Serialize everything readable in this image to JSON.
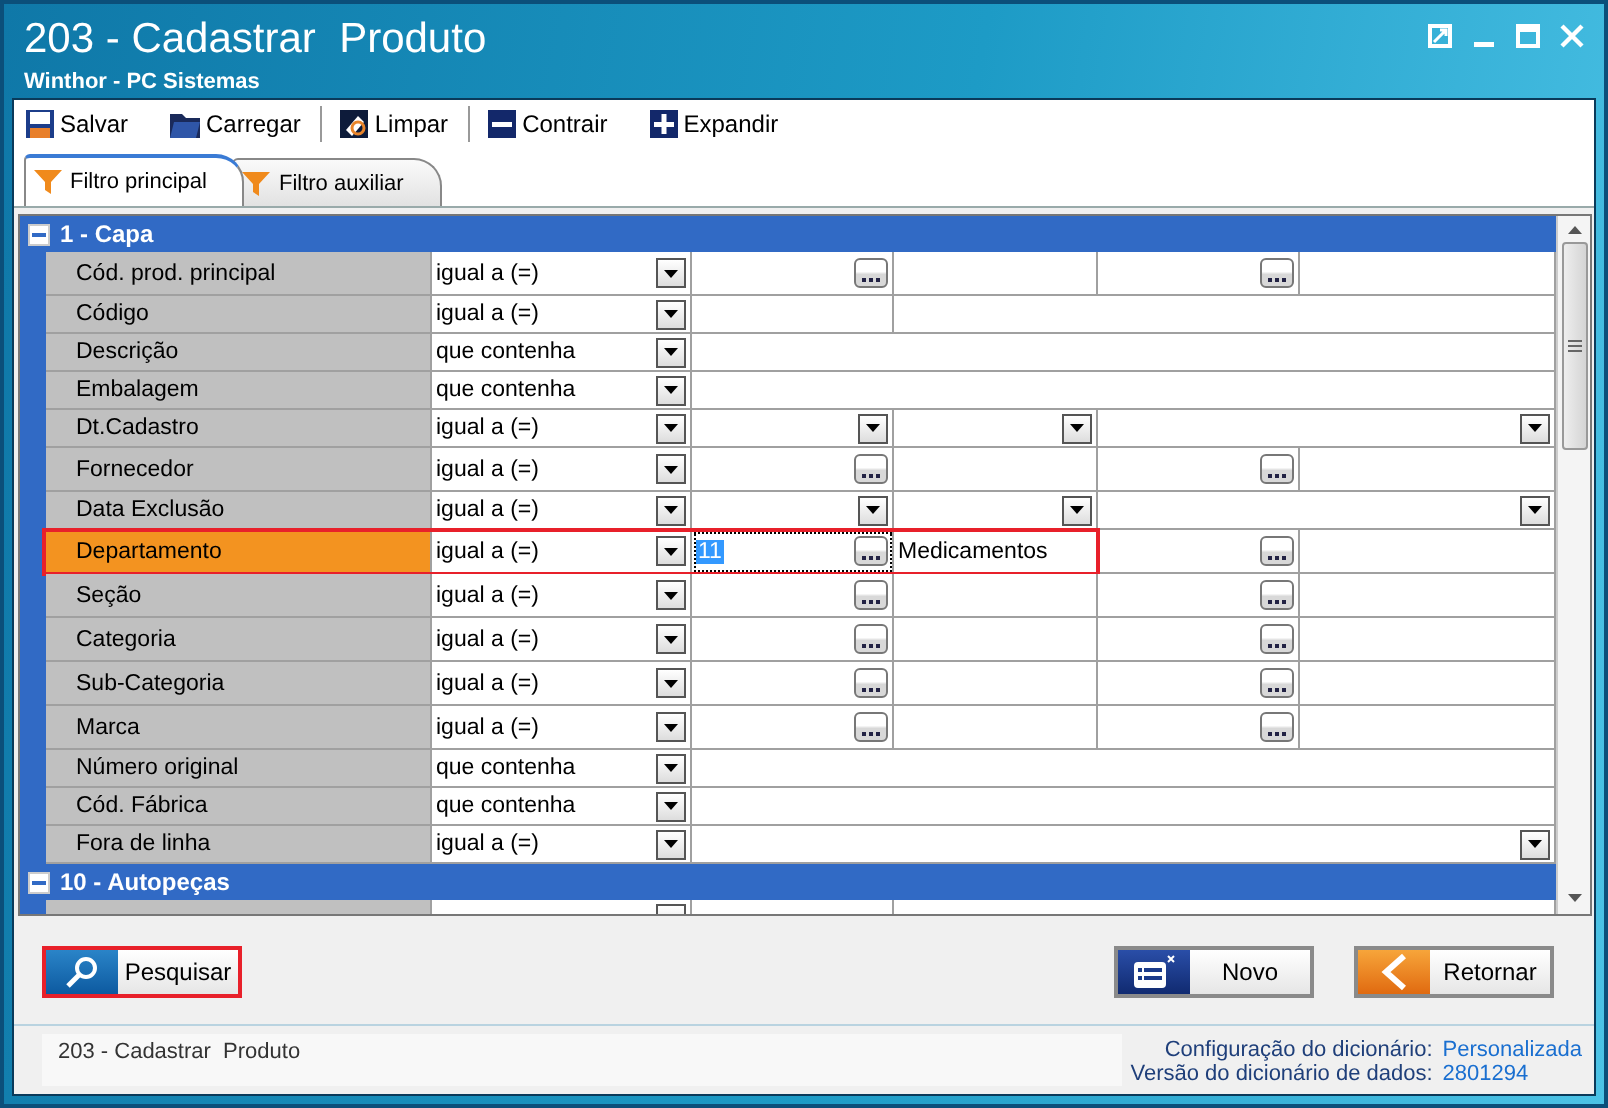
{
  "window": {
    "title": "203 - Cadastrar  Produto",
    "subtitle": "Winthor - PC Sistemas"
  },
  "toolbar": [
    {
      "label": "Salvar"
    },
    {
      "label": "Carregar"
    },
    {
      "label": "Limpar"
    },
    {
      "label": "Contrair"
    },
    {
      "label": "Expandir"
    }
  ],
  "tabs": [
    {
      "label": "Filtro principal",
      "selected": true
    },
    {
      "label": "Filtro auxiliar",
      "selected": false
    }
  ],
  "sections": [
    {
      "title": "1 - Capa",
      "expanded": true,
      "rows": [
        {
          "label": "Cód. prod. principal",
          "operator": "igual a (=)",
          "kind": "lookup",
          "selected": false,
          "highlighted": false
        },
        {
          "label": "Código",
          "operator": "igual a (=)",
          "kind": "text_pair",
          "selected": false,
          "highlighted": false
        },
        {
          "label": "Descrição",
          "operator": "que contenha",
          "kind": "text",
          "selected": false,
          "highlighted": false
        },
        {
          "label": "Embalagem",
          "operator": "que contenha",
          "kind": "text",
          "selected": false,
          "highlighted": false
        },
        {
          "label": "Dt.Cadastro",
          "operator": "igual a (=)",
          "kind": "date_range",
          "selected": false,
          "highlighted": false
        },
        {
          "label": "Fornecedor",
          "operator": "igual a (=)",
          "kind": "lookup",
          "selected": false,
          "highlighted": false
        },
        {
          "label": "Data Exclusão",
          "operator": "igual a (=)",
          "kind": "date_range",
          "selected": false,
          "highlighted": false
        },
        {
          "label": "Departamento",
          "operator": "igual a (=)",
          "kind": "lookup",
          "selected": true,
          "highlighted": true,
          "value": "11",
          "description": "Medicamentos"
        },
        {
          "label": "Seção",
          "operator": "igual a (=)",
          "kind": "lookup",
          "selected": false,
          "highlighted": false
        },
        {
          "label": "Categoria",
          "operator": "igual a (=)",
          "kind": "lookup",
          "selected": false,
          "highlighted": false
        },
        {
          "label": "Sub-Categoria",
          "operator": "igual a (=)",
          "kind": "lookup",
          "selected": false,
          "highlighted": false
        },
        {
          "label": "Marca",
          "operator": "igual a (=)",
          "kind": "lookup",
          "selected": false,
          "highlighted": false
        },
        {
          "label": "Número original",
          "operator": "que contenha",
          "kind": "text",
          "selected": false,
          "highlighted": false
        },
        {
          "label": "Cód. Fábrica",
          "operator": "que contenha",
          "kind": "text",
          "selected": false,
          "highlighted": false
        },
        {
          "label": "Fora de linha",
          "operator": "igual a (=)",
          "kind": "combo",
          "selected": false,
          "highlighted": false
        }
      ]
    },
    {
      "title": "10 - Autopeças",
      "expanded": true
    }
  ],
  "buttons": [
    {
      "label": "Pesquisar",
      "highlighted": true
    },
    {
      "label": "Novo",
      "highlighted": false
    },
    {
      "label": "Retornar",
      "highlighted": false
    }
  ],
  "status_bar": {
    "text": "203 - Cadastrar  Produto",
    "info": [
      {
        "label": "Configuração do dicionário:",
        "value": "Personalizada"
      },
      {
        "label": "Versão do dicionário de dados:",
        "value": "2801294"
      }
    ]
  }
}
